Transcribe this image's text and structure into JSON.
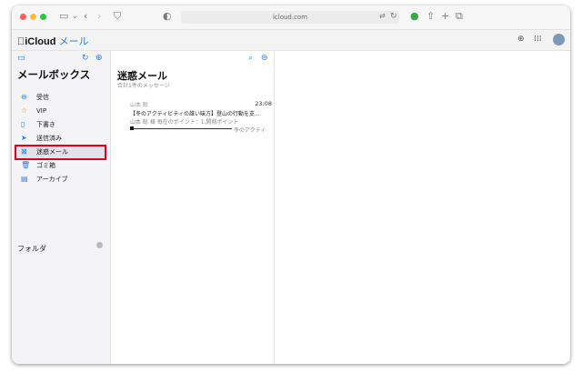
{
  "browser": {
    "address": "icloud.com"
  },
  "app": {
    "brand_apple": "",
    "brand_name": "iCloud",
    "brand_app": "メール"
  },
  "sidebar": {
    "title": "メールボックス",
    "items": [
      {
        "label": "受信",
        "icon": "inbox-icon"
      },
      {
        "label": "VIP",
        "icon": "star-icon"
      },
      {
        "label": "下書き",
        "icon": "document-icon"
      },
      {
        "label": "送信済み",
        "icon": "paper-plane-icon"
      },
      {
        "label": "迷惑メール",
        "icon": "junk-icon",
        "selected": true
      },
      {
        "label": "ゴミ箱",
        "icon": "trash-icon"
      },
      {
        "label": "アーカイブ",
        "icon": "archive-icon"
      }
    ],
    "folders_label": "フォルダ"
  },
  "list": {
    "title": "迷惑メール",
    "subtitle": "合計1件のメッセージ",
    "messages": [
      {
        "from": "山本 聡",
        "time": "23:08",
        "subject": "【冬のアクティビティの誰い味方】登山の行動を支...",
        "preview": "山本 聡 様 毎在のポイント：1,開削ポイント",
        "preview_end": "冬のアクティ"
      }
    ]
  },
  "colors": {
    "accent": "#2a7de1",
    "highlight": "#e0001b"
  }
}
